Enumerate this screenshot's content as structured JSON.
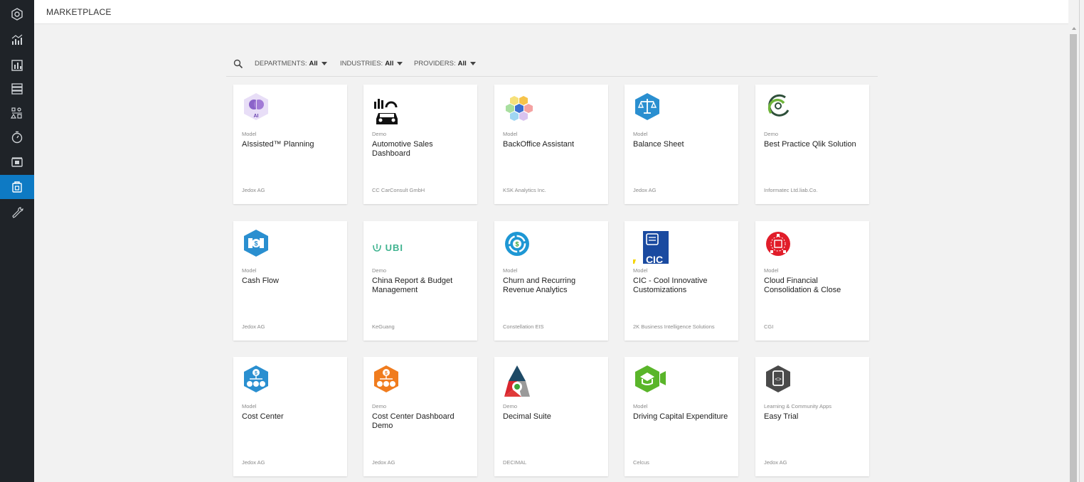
{
  "app": {
    "page_title": "MARKETPLACE"
  },
  "sidebar": {
    "items": [
      {
        "icon": "hexagon-logo-icon",
        "active": false
      },
      {
        "icon": "analytics-icon",
        "active": false
      },
      {
        "icon": "reports-icon",
        "active": false
      },
      {
        "icon": "database-icon",
        "active": false
      },
      {
        "icon": "modeler-icon",
        "active": false
      },
      {
        "icon": "stopwatch-icon",
        "active": false
      },
      {
        "icon": "apps-icon",
        "active": false
      },
      {
        "icon": "marketplace-icon",
        "active": true
      },
      {
        "icon": "wrench-icon",
        "active": false
      }
    ],
    "active_color": "#0e7ac4",
    "background_color": "#1f2328"
  },
  "filters": {
    "departments_label": "DEPARTMENTS:",
    "departments_value": "All",
    "industries_label": "INDUSTRIES:",
    "industries_value": "All",
    "providers_label": "PROVIDERS:",
    "providers_value": "All"
  },
  "cards": [
    {
      "type": "Model",
      "title": "AIssisted™ Planning",
      "provider": "Jedox AG",
      "logo": "ai-brain-icon"
    },
    {
      "type": "Demo",
      "title": "Automotive Sales Dashboard",
      "provider": "CC CarConsult GmbH",
      "logo": "car-dashboard-icon"
    },
    {
      "type": "Model",
      "title": "BackOffice Assistant",
      "provider": "KSK Analytics Inc.",
      "logo": "hexagon-cluster-icon"
    },
    {
      "type": "Model",
      "title": "Balance Sheet",
      "provider": "Jedox AG",
      "logo": "scales-icon"
    },
    {
      "type": "Demo",
      "title": "Best Practice Qlik Solution",
      "provider": "Informatec Ltd.liab.Co.",
      "logo": "swirl-icon"
    },
    {
      "type": "Model",
      "title": "Cash Flow",
      "provider": "Jedox AG",
      "logo": "cash-flow-icon"
    },
    {
      "type": "Demo",
      "title": "China Report & Budget Management",
      "provider": "KeGuang",
      "logo": "ubi-logo-icon",
      "logo_text": "UBI"
    },
    {
      "type": "Model",
      "title": "Churn and Recurring Revenue Analytics",
      "provider": "Constellation EIS",
      "logo": "recurring-revenue-icon"
    },
    {
      "type": "Model",
      "title": "CIC - Cool Innovative Customizations",
      "provider": "2K Business Intelligence Solutions",
      "logo": "cic-icon",
      "logo_text": "CIC"
    },
    {
      "type": "Model",
      "title": "Cloud Financial Consolidation & Close",
      "provider": "CGI",
      "logo": "consolidation-icon"
    },
    {
      "type": "Model",
      "title": "Cost Center",
      "provider": "Jedox AG",
      "logo": "cost-center-icon"
    },
    {
      "type": "Demo",
      "title": "Cost Center Dashboard Demo",
      "provider": "Jedox AG",
      "logo": "cost-center-dashboard-icon"
    },
    {
      "type": "Demo",
      "title": "Decimal Suite",
      "provider": "DECIMAL",
      "logo": "decimal-triangle-icon"
    },
    {
      "type": "Model",
      "title": "Driving Capital Expenditure",
      "provider": "Celcus",
      "logo": "capex-icon"
    },
    {
      "type": "Learning & Community Apps",
      "title": "Easy Trial",
      "provider": "Jedox AG",
      "logo": "easy-trial-icon"
    }
  ]
}
